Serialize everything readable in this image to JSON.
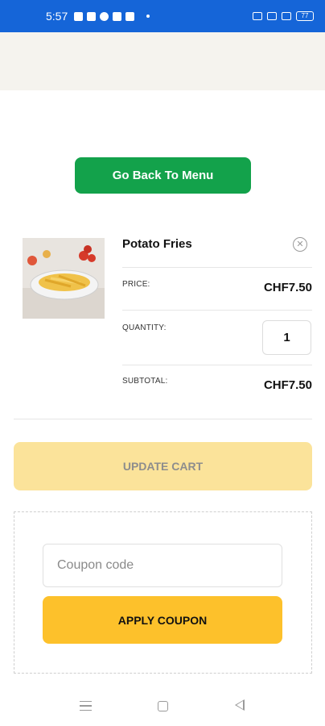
{
  "status_bar": {
    "time": "5:57",
    "battery": "77",
    "icons": [
      "message-icon",
      "youtube-icon",
      "phone-icon",
      "app-icon",
      "ff-icon",
      "dot-icon",
      "signal-icon",
      "wifi-icon",
      "battery-icon"
    ]
  },
  "actions": {
    "back_to_menu": "Go Back To Menu",
    "update_cart": "UPDATE CART",
    "apply_coupon": "APPLY COUPON"
  },
  "cart_item": {
    "name": "Potato Fries",
    "price_label": "PRICE:",
    "price": "CHF7.50",
    "quantity_label": "QUANTITY:",
    "quantity": "1",
    "subtotal_label": "SUBTOTAL:",
    "subtotal": "CHF7.50",
    "remove_symbol": "✕"
  },
  "coupon": {
    "placeholder": "Coupon code",
    "value": ""
  },
  "colors": {
    "status_bar": "#1565d8",
    "primary_green": "#13a24b",
    "update_disabled": "#fbe39a",
    "apply_yellow": "#fdc12b",
    "band_beige": "#f5f3ee"
  }
}
